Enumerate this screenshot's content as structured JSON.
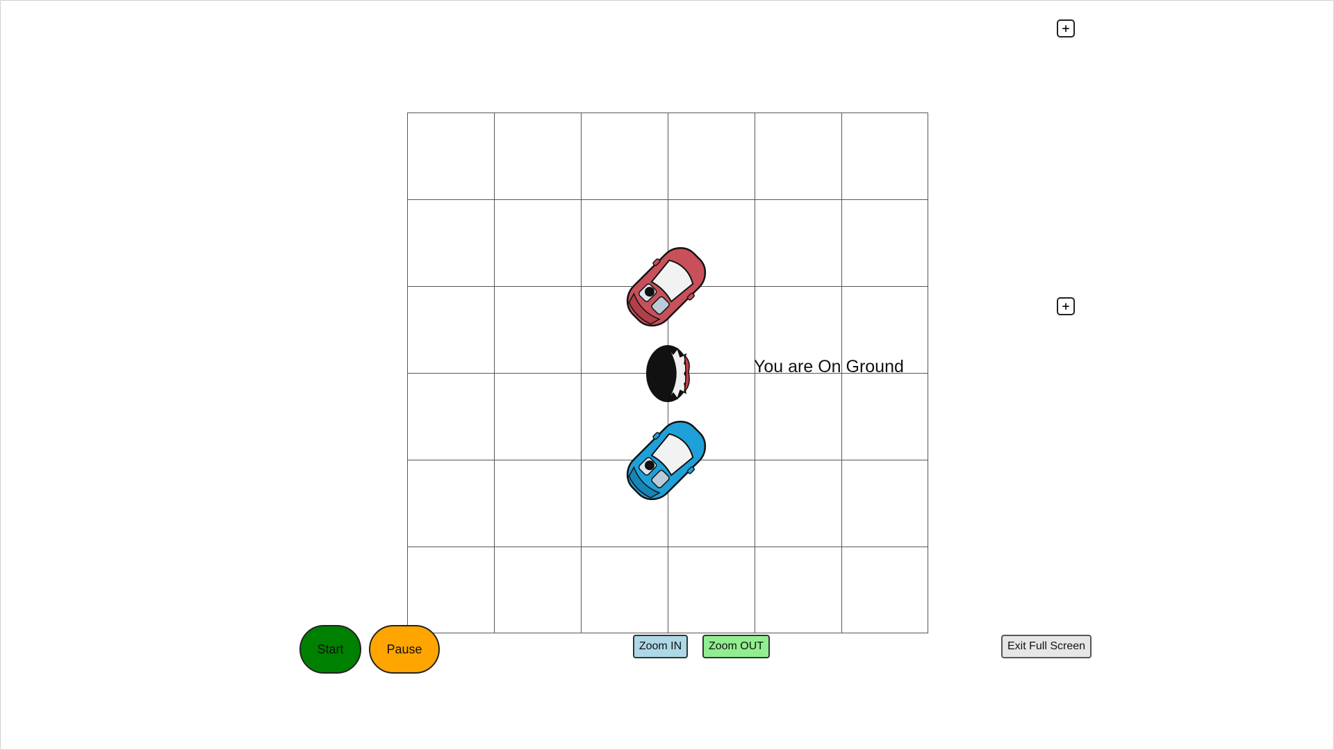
{
  "status": {
    "message": "You are On Ground"
  },
  "controls": {
    "plus_top": "+",
    "plus_mid": "+",
    "start_label": "Start",
    "pause_label": "Pause",
    "zoom_in_label": "Zoom IN",
    "zoom_out_label": "Zoom OUT",
    "exit_fullscreen_label": "Exit Full Screen"
  },
  "board": {
    "rows": 6,
    "cols": 6
  },
  "colors": {
    "start": "#008000",
    "pause": "#ffa500",
    "zoom_in": "#add8e6",
    "zoom_out": "#90ee90",
    "red_car": "#c8505a",
    "blue_car": "#1fa0d8"
  },
  "sprites": [
    "red-car-icon",
    "character-head-icon",
    "blue-car-icon"
  ]
}
